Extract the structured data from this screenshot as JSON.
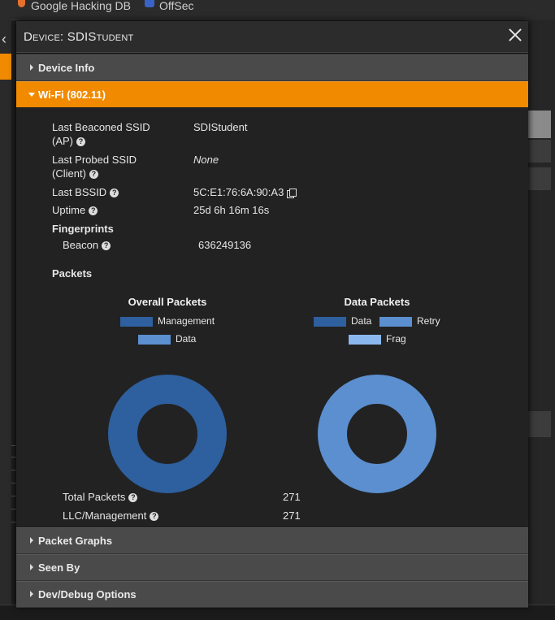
{
  "browser": {
    "bookmarks": [
      {
        "label": "Google Hacking DB",
        "icon": "google-hacking-db-icon"
      },
      {
        "label": "OffSec",
        "icon": "offsec-icon"
      }
    ]
  },
  "modal": {
    "title": "Device: SDIStudent",
    "sections": {
      "device_info": "Device Info",
      "wifi": "Wi-Fi (802.11)",
      "packet_graphs": "Packet Graphs",
      "seen_by": "Seen By",
      "dev_debug": "Dev/Debug Options"
    }
  },
  "wifi": {
    "fields": [
      {
        "label1": "Last Beaconed SSID",
        "label2": "(AP)",
        "value": "SDIStudent"
      },
      {
        "label1": "Last Probed SSID",
        "label2": "(Client)",
        "value": "None"
      },
      {
        "label1": "Last BSSID",
        "label2": "",
        "value": "5C:E1:76:6A:90:A3"
      },
      {
        "label1": "Uptime",
        "label2": "",
        "value": "25d 6h 16m 16s"
      }
    ],
    "fingerprints_heading": "Fingerprints",
    "beacon_label": "Beacon",
    "beacon_value": "636249136",
    "packets_heading": "Packets",
    "totals": [
      {
        "label": "Total Packets",
        "value": "271"
      },
      {
        "label": "LLC/Management",
        "value": "271"
      }
    ]
  },
  "colors": {
    "accent": "#f28a00",
    "management": "#2e5f9e",
    "data": "#5b8fd0",
    "retry": "#5b8fd0",
    "frag": "#8ab8ee"
  },
  "chart_data": [
    {
      "type": "pie",
      "title": "Overall Packets",
      "series": [
        {
          "name": "Management",
          "value": 271,
          "color": "#2e5f9e"
        },
        {
          "name": "Data",
          "value": 0,
          "color": "#5b8fd0"
        }
      ]
    },
    {
      "type": "pie",
      "title": "Data Packets",
      "series": [
        {
          "name": "Data",
          "value": 0,
          "color": "#2e5f9e"
        },
        {
          "name": "Retry",
          "value": 0,
          "color": "#5b8fd0"
        },
        {
          "name": "Frag",
          "value": 0,
          "color": "#8ab8ee"
        }
      ],
      "empty_color": "#5b8fd0"
    }
  ]
}
